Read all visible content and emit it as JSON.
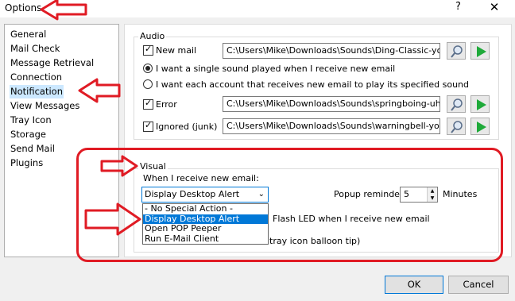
{
  "window": {
    "title": "Options",
    "help_glyph": "?",
    "close_glyph": "✕"
  },
  "nav": {
    "items": [
      "General",
      "Mail Check",
      "Message Retrieval",
      "Connection",
      "Notification",
      "View Messages",
      "Tray Icon",
      "Storage",
      "Send Mail",
      "Plugins"
    ],
    "selected": "Notification"
  },
  "audio": {
    "legend": "Audio",
    "new_mail": {
      "label": "New mail",
      "path": "C:\\Users\\Mike\\Downloads\\Sounds\\Ding-Classic-youvego"
    },
    "radio_single": "I want a single sound played when I receive new email",
    "radio_each": "I want each account that receives new email to play its specified sound",
    "error": {
      "label": "Error",
      "path": "C:\\Users\\Mike\\Downloads\\Sounds\\springboing-uhoh.wav"
    },
    "ignored": {
      "label": "Ignored (junk)",
      "path": "C:\\Users\\Mike\\Downloads\\Sounds\\warningbell-youvegot"
    }
  },
  "visual": {
    "legend": "Visual",
    "when_label": "When I receive new email:",
    "selected_option": "Display Desktop Alert",
    "options": [
      "- No Special Action -",
      "Display Desktop Alert",
      "Open POP Peeper",
      "Run E-Mail Client"
    ],
    "popup_label": "Popup reminder:",
    "popup_value": "5",
    "popup_unit": "Minutes",
    "flash_label": "Flash LED when I receive new email",
    "tray_partial": "tray icon balloon tip)"
  },
  "buttons": {
    "ok": "OK",
    "cancel": "Cancel"
  },
  "colors": {
    "annotation": "#e01b24",
    "selection": "#0078d7",
    "nav_selection": "#cce8ff"
  }
}
